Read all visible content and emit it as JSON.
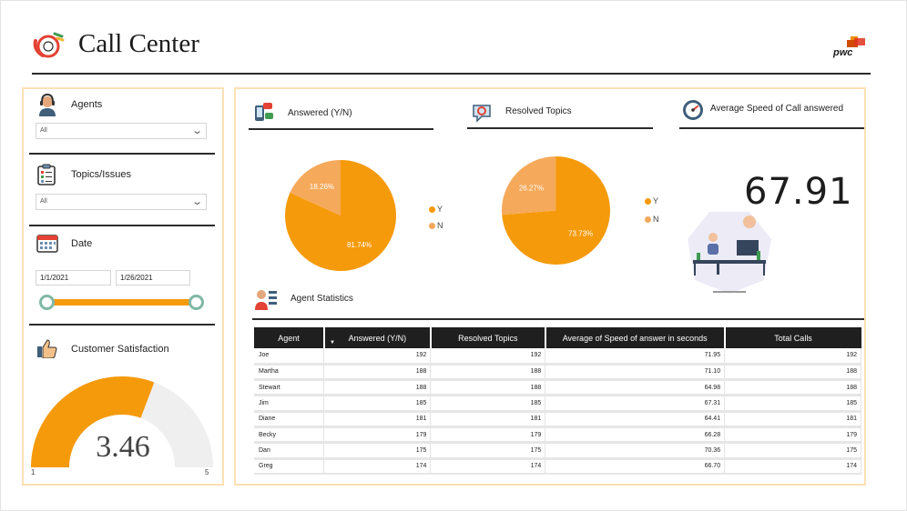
{
  "header": {
    "title": "Call Center",
    "brand": "pwc"
  },
  "slicers": {
    "agents": {
      "title": "Agents",
      "value": "All"
    },
    "topics": {
      "title": "Topics/Issues",
      "value": "All"
    },
    "date": {
      "title": "Date",
      "start": "1/1/2021",
      "end": "1/26/2021"
    },
    "satisfaction": {
      "title": "Customer Satisfaction",
      "value": "3.46",
      "numeric": 3.46,
      "min": "1",
      "max": "5",
      "min_value": 1,
      "max_value": 5
    }
  },
  "cards": {
    "answered": {
      "title": "Answered (Y/N)",
      "legend_y": "Y",
      "legend_n": "N",
      "label_y": "81.74%",
      "label_n": "18.26%"
    },
    "resolved": {
      "title": "Resolved Topics",
      "legend_y": "Y",
      "legend_n": "N",
      "label_y": "73.73%",
      "label_n": "26.27%"
    },
    "speed": {
      "title": "Average Speed of Call answered",
      "value": "67.91"
    }
  },
  "colors": {
    "accent": "#f59a0a",
    "secondary": "#f5a95a",
    "gauge_bg": "#efefef",
    "handle": "#7fb8a6",
    "header_bg": "#1f1f1f"
  },
  "chart_data": [
    {
      "type": "pie",
      "title": "Answered (Y/N)",
      "categories": [
        "Y",
        "N"
      ],
      "values": [
        81.74,
        18.26
      ]
    },
    {
      "type": "pie",
      "title": "Resolved Topics",
      "categories": [
        "Y",
        "N"
      ],
      "values": [
        73.73,
        26.27
      ]
    }
  ],
  "agent_stats": {
    "title": "Agent Statistics",
    "columns": [
      "Agent",
      "Answered (Y/N)",
      "Resolved Topics",
      "Average of Speed of answer in seconds",
      "Total Calls"
    ],
    "rows": [
      [
        "Joe",
        "192",
        "192",
        "71.95",
        "192"
      ],
      [
        "Martha",
        "188",
        "188",
        "71.10",
        "188"
      ],
      [
        "Stewart",
        "188",
        "188",
        "64.98",
        "188"
      ],
      [
        "Jim",
        "185",
        "185",
        "67.31",
        "185"
      ],
      [
        "Diane",
        "181",
        "181",
        "64.41",
        "181"
      ],
      [
        "Becky",
        "179",
        "179",
        "66.28",
        "179"
      ],
      [
        "Dan",
        "175",
        "175",
        "70.36",
        "175"
      ],
      [
        "Greg",
        "174",
        "174",
        "66.70",
        "174"
      ]
    ]
  },
  "icons": {
    "header": "call-center-phone-icon",
    "agents": "agent-headset-icon",
    "topics": "clipboard-list-icon",
    "date": "calendar-icon",
    "satisfaction": "thumbs-up-icon",
    "answered": "phone-chat-icon",
    "resolved": "support-chat-icon",
    "speed": "speedometer-icon",
    "agent_stats": "agent-stats-icon",
    "illustration": "call-center-agent-illustration"
  }
}
